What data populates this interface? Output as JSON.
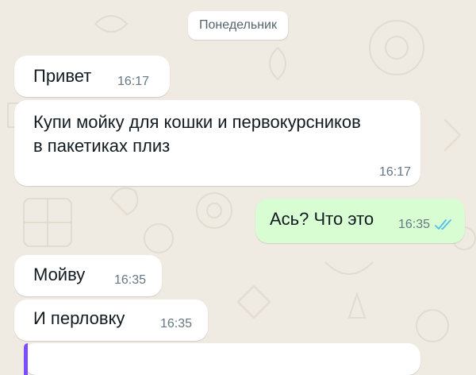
{
  "chat": {
    "date_separator": "Понедельник",
    "messages": [
      {
        "direction": "incoming",
        "text": "Привет",
        "time": "16:17"
      },
      {
        "direction": "incoming",
        "text": "Купи мойку для кошки и первокурсников в пакетиках плиз",
        "time": "16:17"
      },
      {
        "direction": "outgoing",
        "text": "Ась? Что это",
        "time": "16:35",
        "status_icon": "double-check-read-icon"
      },
      {
        "direction": "incoming",
        "text": "Мойву",
        "time": "16:35"
      },
      {
        "direction": "incoming",
        "text": "И перловку",
        "time": "16:35"
      }
    ]
  },
  "colors": {
    "wallpaper": "#efeae2",
    "incoming_bubble": "#ffffff",
    "outgoing_bubble": "#d9fdd3",
    "read_ticks": "#53bdeb",
    "quote_accent": "#7c4dff"
  }
}
